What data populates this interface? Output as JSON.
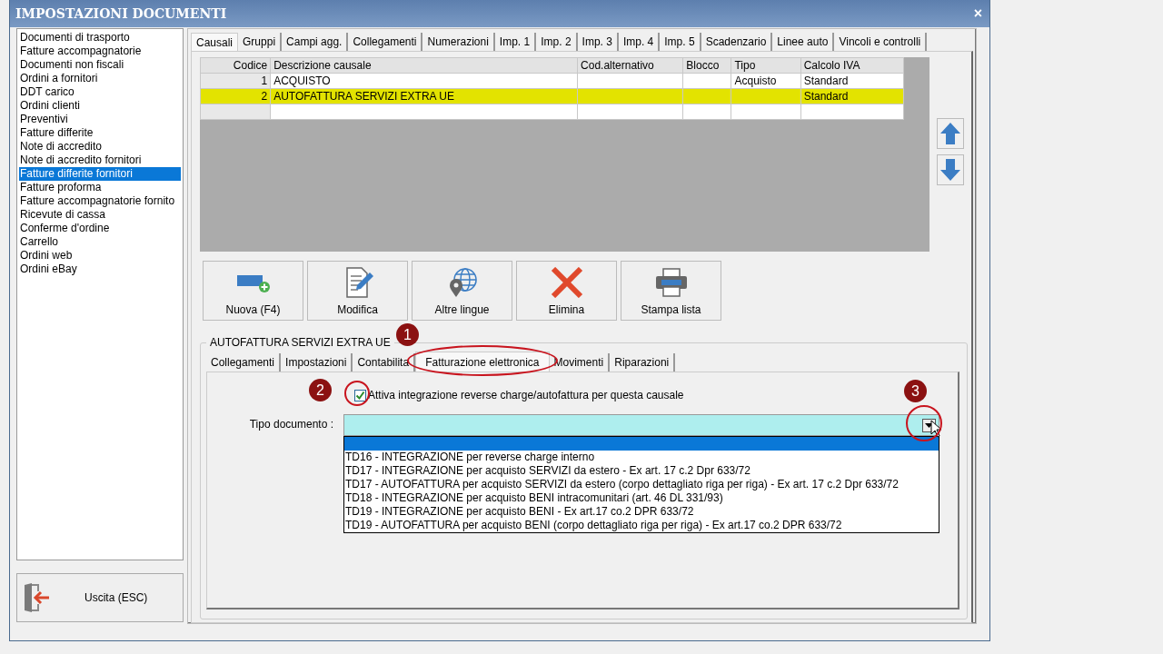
{
  "window": {
    "title": "IMPOSTAZIONI DOCUMENTI",
    "close": "×"
  },
  "sidebar": {
    "items": [
      {
        "label": "Documenti di trasporto",
        "selected": false
      },
      {
        "label": "Fatture accompagnatorie",
        "selected": false
      },
      {
        "label": "Documenti non fiscali",
        "selected": false
      },
      {
        "label": "Ordini a fornitori",
        "selected": false
      },
      {
        "label": "DDT carico",
        "selected": false
      },
      {
        "label": "Ordini clienti",
        "selected": false
      },
      {
        "label": "Preventivi",
        "selected": false
      },
      {
        "label": "Fatture differite",
        "selected": false
      },
      {
        "label": "Note di accredito",
        "selected": false
      },
      {
        "label": "Note di accredito fornitori",
        "selected": false
      },
      {
        "label": "Fatture differite fornitori",
        "selected": true
      },
      {
        "label": "Fatture proforma",
        "selected": false
      },
      {
        "label": "Fatture accompagnatorie fornito",
        "selected": false
      },
      {
        "label": "Ricevute di cassa",
        "selected": false
      },
      {
        "label": "Conferme d'ordine",
        "selected": false
      },
      {
        "label": "Carrello",
        "selected": false
      },
      {
        "label": "Ordini web",
        "selected": false
      },
      {
        "label": "Ordini eBay",
        "selected": false
      }
    ]
  },
  "exit_button": "Uscita (ESC)",
  "tabs": [
    {
      "label": "Causali",
      "selected": true
    },
    {
      "label": "Gruppi",
      "selected": false
    },
    {
      "label": "Campi agg.",
      "selected": false
    },
    {
      "label": "Collegamenti",
      "selected": false
    },
    {
      "label": "Numerazioni",
      "selected": false
    },
    {
      "label": "Imp. 1",
      "selected": false
    },
    {
      "label": "Imp. 2",
      "selected": false
    },
    {
      "label": "Imp. 3",
      "selected": false
    },
    {
      "label": "Imp. 4",
      "selected": false
    },
    {
      "label": "Imp. 5",
      "selected": false
    },
    {
      "label": "Scadenzario",
      "selected": false
    },
    {
      "label": "Linee auto",
      "selected": false
    },
    {
      "label": "Vincoli e controlli",
      "selected": false
    }
  ],
  "table": {
    "columns": [
      "Codice",
      "Descrizione causale",
      "Cod.alternativo",
      "Blocco",
      "Tipo",
      "Calcolo IVA"
    ],
    "rows": [
      {
        "cells": [
          "1",
          "ACQUISTO",
          "",
          "",
          "Acquisto",
          "Standard"
        ],
        "selected": false
      },
      {
        "cells": [
          "2",
          "AUTOFATTURA SERVIZI EXTRA UE",
          "",
          "",
          "",
          "Standard"
        ],
        "selected": true
      }
    ]
  },
  "toolbar": [
    {
      "label": "Nuova (F4)",
      "kind": "new"
    },
    {
      "label": "Modifica",
      "kind": "edit"
    },
    {
      "label": "Altre lingue",
      "kind": "languages"
    },
    {
      "label": "Elimina",
      "kind": "delete"
    },
    {
      "label": "Stampa lista",
      "kind": "print"
    }
  ],
  "detail": {
    "title": "AUTOFATTURA SERVIZI EXTRA UE",
    "tabs": [
      {
        "label": "Collegamenti",
        "selected": false
      },
      {
        "label": "Impostazioni",
        "selected": false
      },
      {
        "label": "Contabilita",
        "selected": false
      },
      {
        "label": "Fatturazione elettronica",
        "selected": true
      },
      {
        "label": "Movimenti",
        "selected": false
      },
      {
        "label": "Riparazioni",
        "selected": false
      }
    ],
    "reverse_charge": {
      "label": "Attiva integrazione reverse charge/autofattura per questa causale",
      "checked": true
    },
    "document_type": {
      "label": "Tipo documento :",
      "empty_option_selected": true,
      "options": [
        {
          "label": "TD16 - INTEGRAZIONE per reverse charge interno",
          "selected": false
        },
        {
          "label": "TD17 - INTEGRAZIONE per acquisto SERVIZI da estero - Ex art. 17 c.2 Dpr 633/72",
          "selected": false
        },
        {
          "label": "TD17 - AUTOFATTURA per acquisto SERVIZI da estero (corpo dettagliato riga per riga) - Ex art. 17 c.2 Dpr 633/72",
          "selected": false
        },
        {
          "label": "TD18 - INTEGRAZIONE per acquisto BENI intracomunitari (art. 46 DL 331/93)",
          "selected": false
        },
        {
          "label": "TD19 - INTEGRAZIONE per acquisto BENI - Ex art.17 co.2 DPR 633/72",
          "selected": false
        },
        {
          "label": "TD19 - AUTOFATTURA per acquisto BENI (corpo dettagliato riga per riga) - Ex art.17 co.2 DPR 633/72",
          "selected": false
        }
      ]
    }
  },
  "callouts": [
    "1",
    "2",
    "3"
  ]
}
